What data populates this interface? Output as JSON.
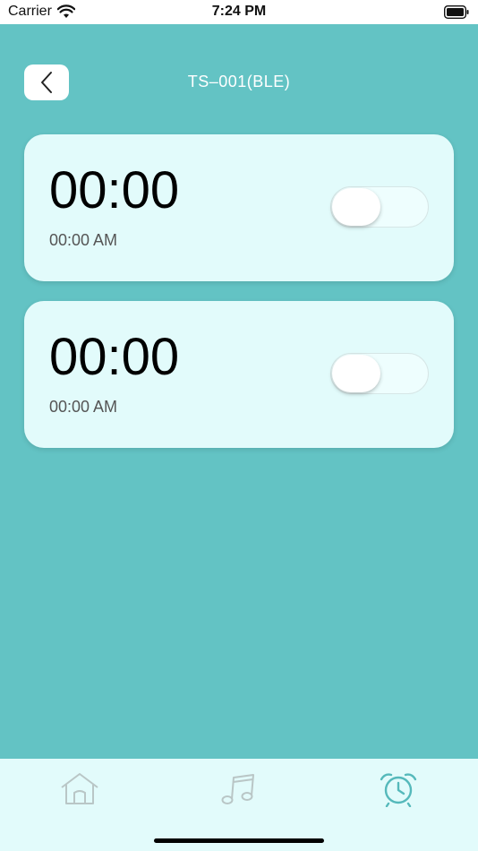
{
  "status_bar": {
    "carrier": "Carrier",
    "time": "7:24 PM"
  },
  "nav": {
    "title": "TS–001(BLE)"
  },
  "alarms": [
    {
      "time": "00:00",
      "subtitle": "00:00 AM",
      "enabled": false
    },
    {
      "time": "00:00",
      "subtitle": "00:00 AM",
      "enabled": false
    }
  ],
  "tabs": [
    {
      "icon": "home-icon",
      "active": false
    },
    {
      "icon": "music-note-icon",
      "active": false
    },
    {
      "icon": "alarm-clock-icon",
      "active": true
    }
  ],
  "colors": {
    "background": "#63c3c4",
    "card": "#e2fbfb",
    "tab_inactive": "#b9c6c6",
    "tab_active": "#55b9bb"
  }
}
